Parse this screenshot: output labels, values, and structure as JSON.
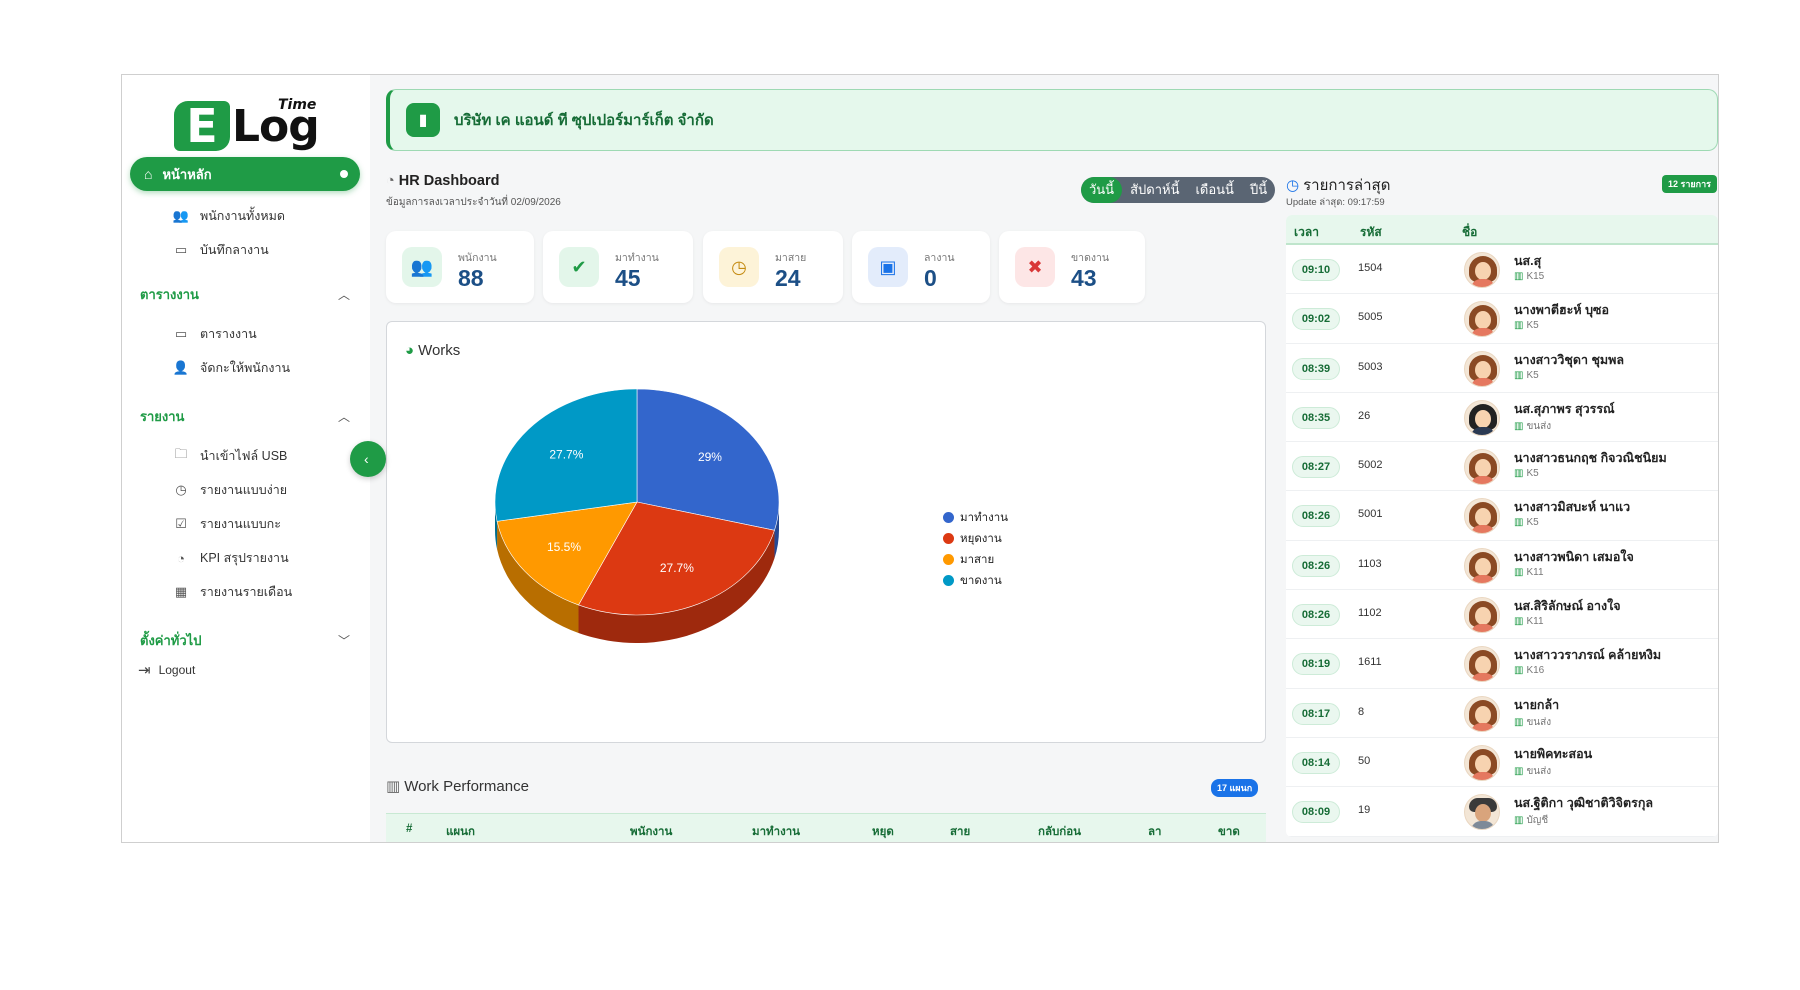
{
  "logo": {
    "letter": "E",
    "word": "Log",
    "sup": "Time"
  },
  "sidebar": {
    "home": "หน้าหลัก",
    "items_top": [
      {
        "label": "พนักงานทั้งหมด",
        "icon": "users-icon"
      },
      {
        "label": "บันทึกลางาน",
        "icon": "calendar-icon"
      }
    ],
    "schedule_section": "ตารางงาน",
    "schedule_items": [
      {
        "label": "ตารางงาน",
        "icon": "calendar-icon"
      },
      {
        "label": "จัดกะให้พนักงาน",
        "icon": "user-plus-icon"
      }
    ],
    "report_section": "รายงาน",
    "report_items": [
      {
        "label": "นำเข้าไฟล์ USB",
        "icon": "folder-icon"
      },
      {
        "label": "รายงานแบบง่าย",
        "icon": "clock-icon"
      },
      {
        "label": "รายงานแบบกะ",
        "icon": "calendar-check-icon"
      },
      {
        "label": "KPI สรุปรายงาน",
        "icon": "gauge-icon"
      },
      {
        "label": "รายงานรายเดือน",
        "icon": "calendar-grid-icon"
      }
    ],
    "settings_section": "ตั้งค่าทั่วไป",
    "logout": "Logout"
  },
  "company": {
    "name": "บริษัท เค แอนด์ ที ซุปเปอร์มาร์เก็ต จำกัด"
  },
  "dashboard": {
    "title": "HR Dashboard",
    "subtitle": "ข้อมูลการลงเวลาประจำวันที่ 02/09/2026",
    "periods": [
      "วันนี้",
      "สัปดาห์นี้",
      "เดือนนี้",
      "ปีนี้"
    ],
    "active_period": "วันนี้",
    "stats": [
      {
        "label": "พนักงาน",
        "value": "88",
        "icon": "users-icon",
        "bg": "#e3f6ea",
        "fg": "#1f9b46"
      },
      {
        "label": "มาทำงาน",
        "value": "45",
        "icon": "check-circle-icon",
        "bg": "#e3f6ea",
        "fg": "#1f9b46"
      },
      {
        "label": "มาสาย",
        "value": "24",
        "icon": "clock-icon",
        "bg": "#fdf3d8",
        "fg": "#c48a10"
      },
      {
        "label": "ลางาน",
        "value": "0",
        "icon": "calendar-icon",
        "bg": "#e3ecfb",
        "fg": "#1a73e8"
      },
      {
        "label": "ขาดงาน",
        "value": "43",
        "icon": "user-x-icon",
        "bg": "#fde6e6",
        "fg": "#d93838"
      }
    ]
  },
  "works": {
    "title": "Works",
    "chart_data": {
      "type": "pie",
      "title": "Works",
      "categories": [
        "มาทำงาน",
        "หยุดงาน",
        "มาสาย",
        "ขาดงาน"
      ],
      "values": [
        29,
        27.7,
        15.5,
        27.7
      ],
      "labels": [
        "29%",
        "27.7%",
        "15.5%",
        "27.7%"
      ],
      "colors": [
        "#3366cc",
        "#dc3912",
        "#ff9900",
        "#0099c6"
      ],
      "legend_position": "right"
    }
  },
  "performance": {
    "title": "Work Performance",
    "badge": "17 แผนก",
    "columns": [
      "#",
      "แผนก",
      "พนักงาน",
      "มาทำงาน",
      "หยุด",
      "สาย",
      "กลับก่อน",
      "ลา",
      "ขาด"
    ]
  },
  "recent": {
    "title": "รายการล่าสุด",
    "subtitle": "Update ล่าสุด: 09:17:59",
    "badge": "12 รายการ",
    "columns": [
      "เวลา",
      "รหัส",
      "ชื่อ"
    ],
    "rows": [
      {
        "time": "09:10",
        "code": "1504",
        "name": "นส.สุ",
        "dept": "K15",
        "avatar": "girl"
      },
      {
        "time": "09:02",
        "code": "5005",
        "name": "นางพาตีฮะห์ บุซอ",
        "dept": "K5",
        "avatar": "girl"
      },
      {
        "time": "08:39",
        "code": "5003",
        "name": "นางสาววิชุดา ชุมพล",
        "dept": "K5",
        "avatar": "girl"
      },
      {
        "time": "08:35",
        "code": "26",
        "name": "นส.สุภาพร สุวรรณ์",
        "dept": "ขนส่ง",
        "avatar": "dark"
      },
      {
        "time": "08:27",
        "code": "5002",
        "name": "นางสาวธนกฤช กิจวณิชนิยม",
        "dept": "K5",
        "avatar": "girl"
      },
      {
        "time": "08:26",
        "code": "5001",
        "name": "นางสาวมิสบะห์ นาแว",
        "dept": "K5",
        "avatar": "girl"
      },
      {
        "time": "08:26",
        "code": "1103",
        "name": "นางสาวพนิดา เสมอใจ",
        "dept": "K11",
        "avatar": "girl"
      },
      {
        "time": "08:26",
        "code": "1102",
        "name": "นส.สิริลักษณ์ อางใจ",
        "dept": "K11",
        "avatar": "girl"
      },
      {
        "time": "08:19",
        "code": "1611",
        "name": "นางสาววราภรณ์ คล้ายหงิม",
        "dept": "K16",
        "avatar": "girl"
      },
      {
        "time": "08:17",
        "code": "8",
        "name": "นายกล้า",
        "dept": "ขนส่ง",
        "avatar": "girl"
      },
      {
        "time": "08:14",
        "code": "50",
        "name": "นายพิคทะสอน",
        "dept": "ขนส่ง",
        "avatar": "girl"
      },
      {
        "time": "08:09",
        "code": "19",
        "name": "นส.ฐิติกา วุฒิชาติวิจิตรกุล",
        "dept": "บัญชี",
        "avatar": "man"
      }
    ]
  }
}
